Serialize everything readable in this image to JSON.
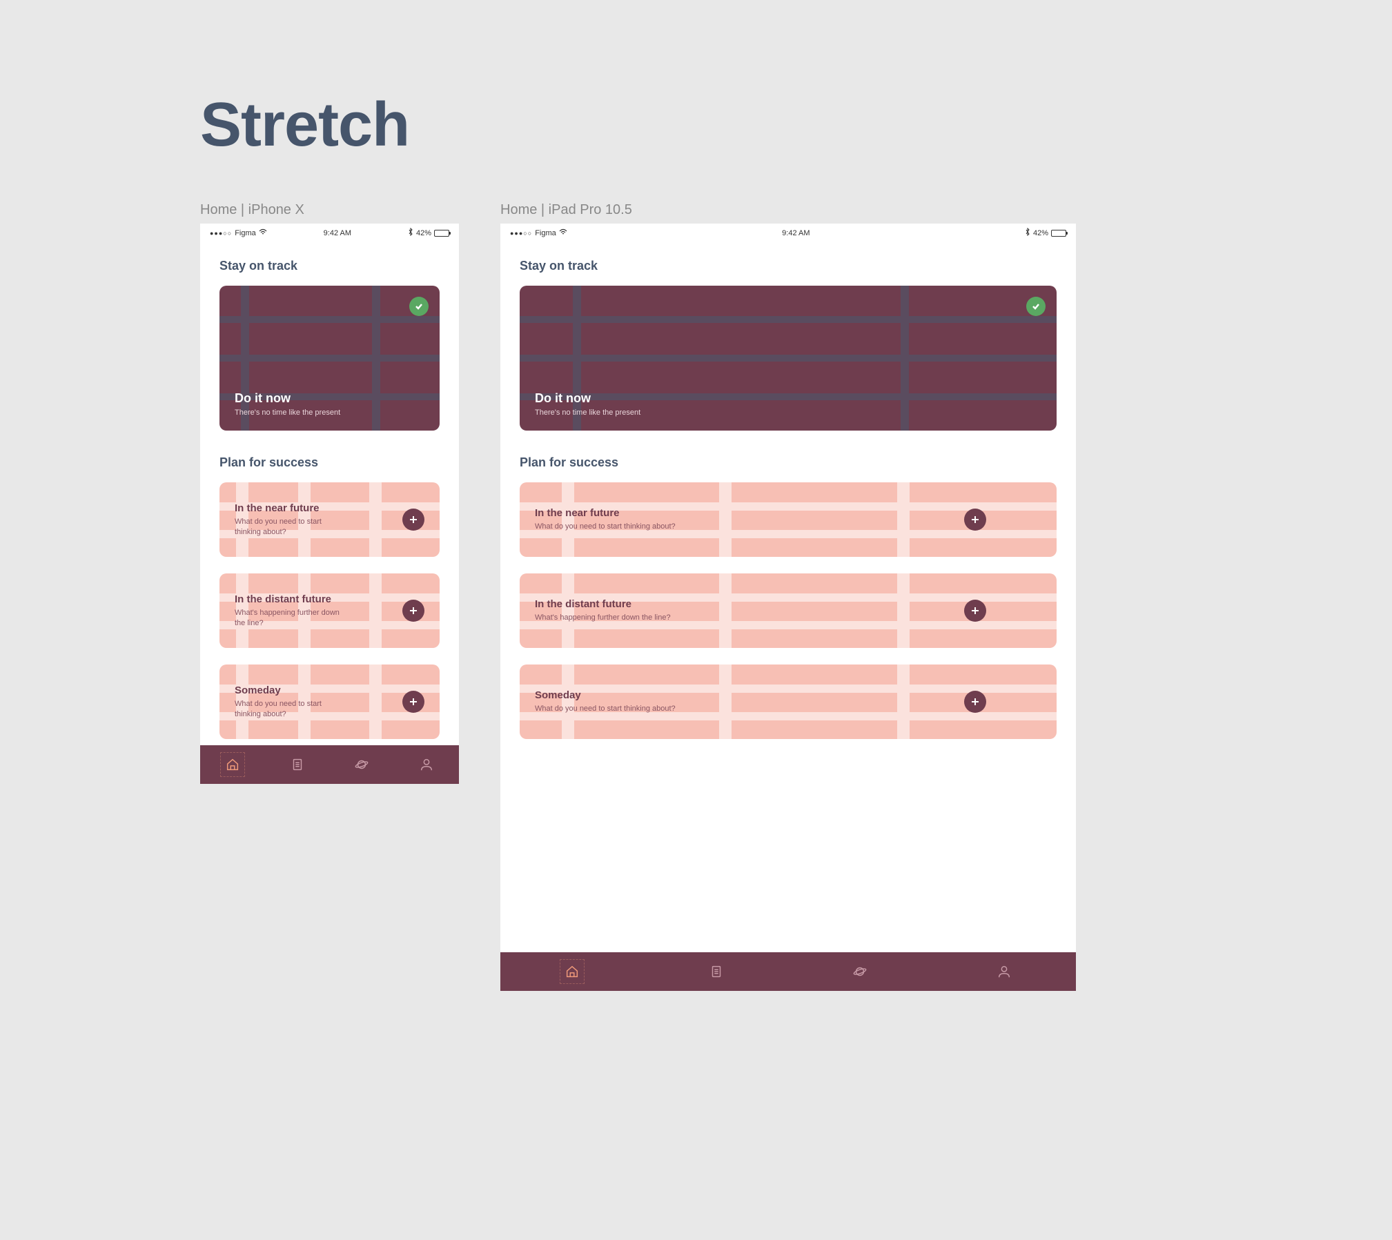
{
  "page": {
    "title": "Stretch"
  },
  "frames": {
    "iphone": {
      "label": "Home | iPhone X"
    },
    "ipad": {
      "label": "Home | iPad Pro 10.5"
    }
  },
  "status_bar": {
    "carrier": "Figma",
    "time": "9:42 AM",
    "battery_pct": "42%",
    "bluetooth": true
  },
  "sections": {
    "track": {
      "heading": "Stay on track"
    },
    "plan": {
      "heading": "Plan for success"
    }
  },
  "hero": {
    "title": "Do it now",
    "subtitle": "There's no time like the present"
  },
  "plan_items": [
    {
      "title": "In the near future",
      "subtitle": "What do you need to start thinking about?"
    },
    {
      "title": "In the distant future",
      "subtitle": "What's happening further down the line?"
    },
    {
      "title": "Someday",
      "subtitle": "What do you need to start thinking about?"
    }
  ],
  "tabs": [
    {
      "id": "home",
      "icon": "home-icon",
      "active": true
    },
    {
      "id": "list",
      "icon": "list-icon",
      "active": false
    },
    {
      "id": "planet",
      "icon": "planet-icon",
      "active": false
    },
    {
      "id": "profile",
      "icon": "profile-icon",
      "active": false
    }
  ],
  "colors": {
    "page_bg": "#e8e8e8",
    "text_heading": "#46556b",
    "hero_bg": "#6f3d4e",
    "hero_grid": "#4a5a6d",
    "check_badge": "#5aa862",
    "plan_bg": "#f7bfb4",
    "plan_title": "#6f3d4e",
    "tabbar_bg": "#6f3d4e",
    "tab_inactive": "#c79aa6",
    "tab_active": "#f09a7a"
  }
}
